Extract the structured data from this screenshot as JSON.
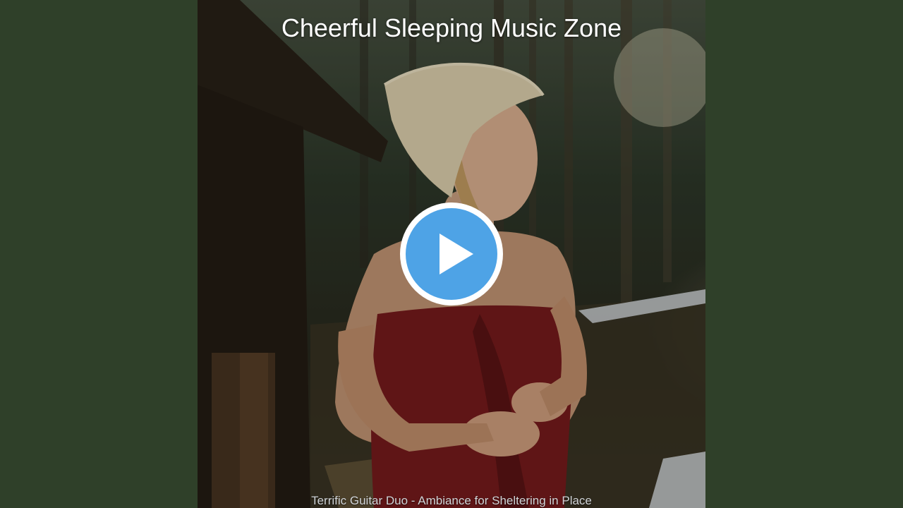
{
  "video": {
    "channel_title": "Cheerful Sleeping Music Zone",
    "track_title": "Terrific Guitar Duo - Ambiance for Sheltering in Place",
    "play_icon": "play-icon"
  },
  "colors": {
    "background": "#2f4029",
    "play_button": "#4ea3e6",
    "play_ring": "#ffffff",
    "title_text": "#ffffff"
  }
}
